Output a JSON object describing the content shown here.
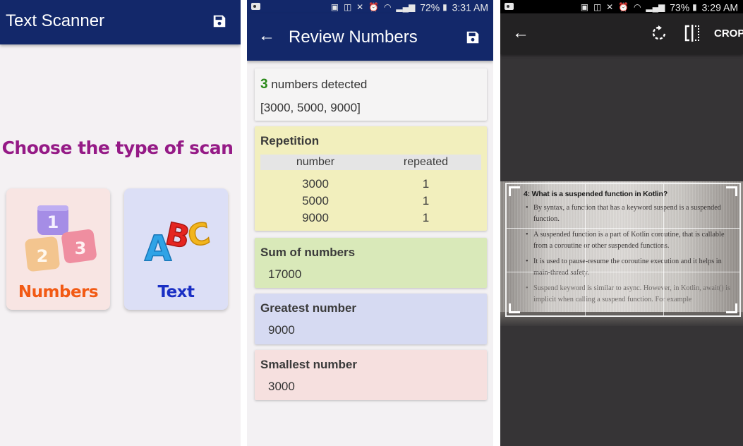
{
  "scan_type_screen": {
    "app_title": "Text Scanner",
    "save_icon": "save-icon",
    "prompt": "Choose the type of scan",
    "options": [
      {
        "label": "Numbers",
        "icon": "number-blocks-icon",
        "color": "#f25a14",
        "background": "#f8e5e3"
      },
      {
        "label": "Text",
        "icon": "abc-letters-icon",
        "color": "#1a2fc4",
        "background": "#dcdff6"
      }
    ],
    "accent_color": "#13286a",
    "prompt_color": "#951a86"
  },
  "review_screen": {
    "status_bar": {
      "battery": "72%",
      "time": "3:31 AM"
    },
    "title": "Review Numbers",
    "back_icon": "arrow-back-icon",
    "save_icon": "save-icon",
    "detected": {
      "count": "3",
      "count_suffix": " numbers detected",
      "list": "[3000, 5000, 9000]"
    },
    "repetition": {
      "heading": "Repetition",
      "columns": [
        "number",
        "repeated"
      ],
      "rows": [
        {
          "number": "3000",
          "repeated": "1"
        },
        {
          "number": "5000",
          "repeated": "1"
        },
        {
          "number": "9000",
          "repeated": "1"
        }
      ]
    },
    "sum": {
      "heading": "Sum of numbers",
      "value": "17000"
    },
    "greatest": {
      "heading": "Greatest number",
      "value": "9000"
    },
    "smallest": {
      "heading": "Smallest number",
      "value": "3000"
    }
  },
  "crop_screen": {
    "status_bar": {
      "battery": "73%",
      "time": "3:29 AM"
    },
    "back_icon": "arrow-back-icon",
    "rotate_icon": "rotate-icon",
    "flip_icon": "flip-icon",
    "crop_label": "CROP",
    "document": {
      "heading": "4: What is a suspended function in Kotlin?",
      "bullets": [
        "By syntax, a function that has a keyword suspend is a suspended function.",
        "A suspended function is a part of Kotlin coroutine, that is callable from a coroutine or other suspended functions.",
        "It is used to pause-resume the coroutine execution and it helps in main-thread safety.",
        "Suspend keyword is similar to async. However, in Kotlin, await() is implicit when calling a suspend function. For example"
      ]
    }
  }
}
